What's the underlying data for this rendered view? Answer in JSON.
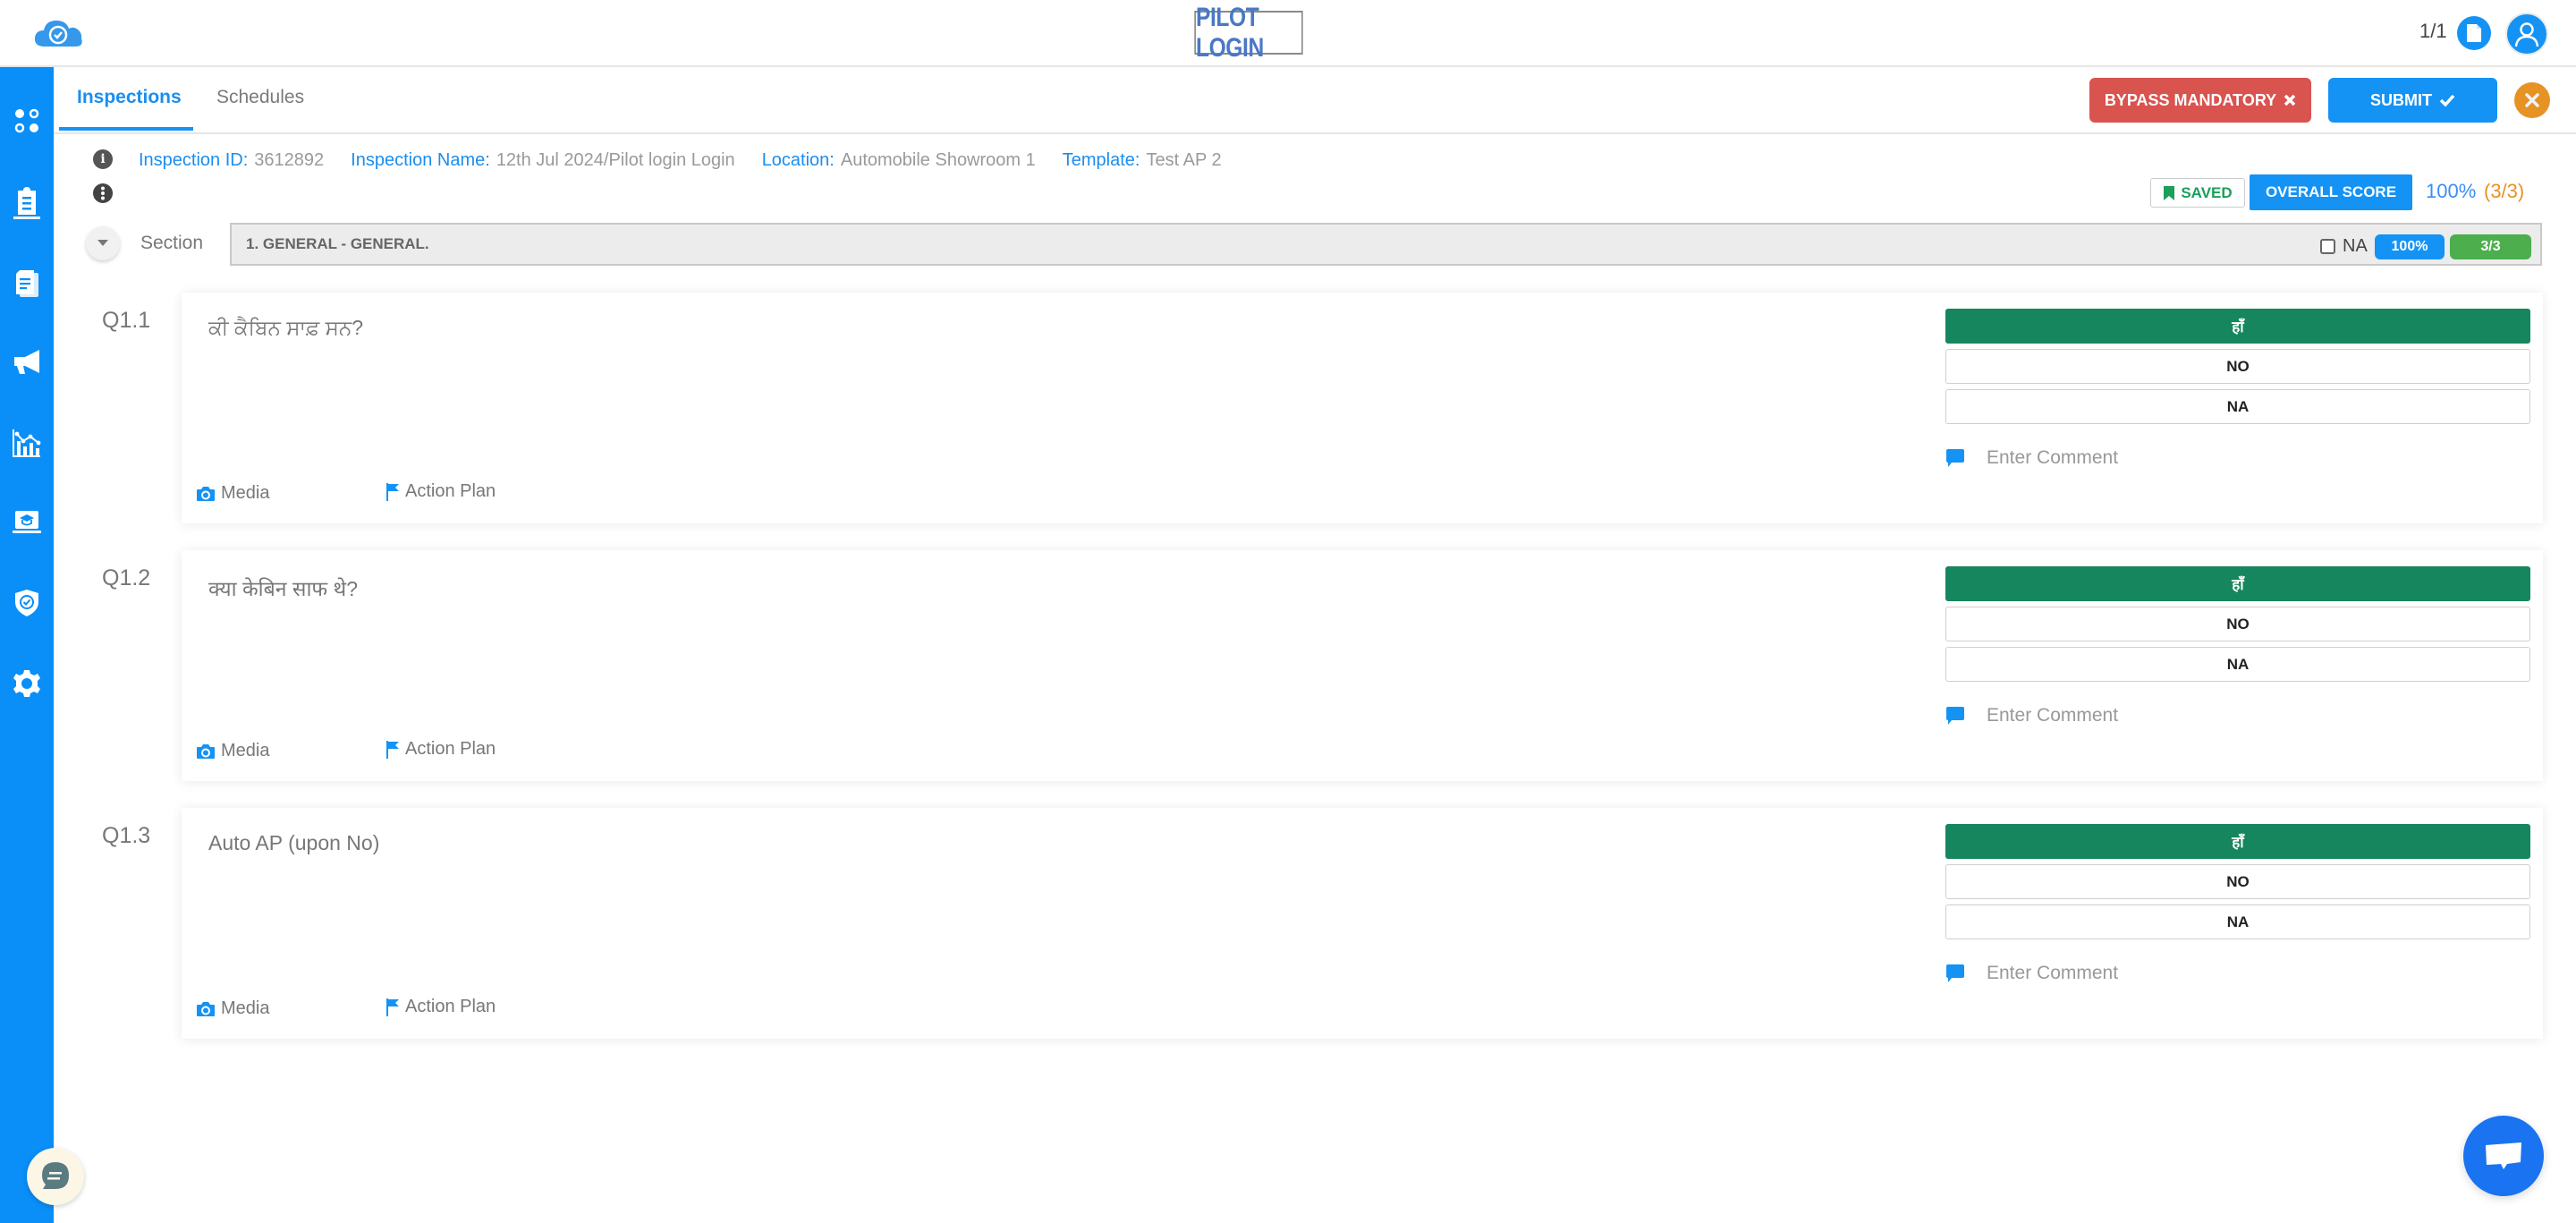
{
  "header": {
    "brand": "PILOT LOGIN",
    "page_count": "1/1",
    "icons": {
      "logo": "cloud-check-icon",
      "doc": "file-icon",
      "user": "user-icon"
    }
  },
  "sidebar": {
    "items": [
      {
        "name": "dashboard",
        "icon": "apps-icon"
      },
      {
        "name": "inspections",
        "icon": "clipboard-icon"
      },
      {
        "name": "documents",
        "icon": "documents-icon"
      },
      {
        "name": "announcements",
        "icon": "megaphone-icon"
      },
      {
        "name": "analytics",
        "icon": "chart-icon"
      },
      {
        "name": "training",
        "icon": "graduation-laptop-icon"
      },
      {
        "name": "compliance",
        "icon": "shield-check-icon"
      },
      {
        "name": "settings",
        "icon": "gear-icon"
      }
    ]
  },
  "tabs": [
    {
      "label": "Inspections",
      "active": true
    },
    {
      "label": "Schedules",
      "active": false
    }
  ],
  "actions": {
    "bypass_label": "BYPASS MANDATORY",
    "submit_label": "SUBMIT",
    "colors": {
      "bypass": "#d9534f",
      "submit": "#1493f5",
      "close": "#e69224"
    }
  },
  "info": {
    "inspection_id_label": "Inspection ID:",
    "inspection_id": "3612892",
    "inspection_name_label": "Inspection Name:",
    "inspection_name": "12th Jul 2024/Pilot login Login",
    "location_label": "Location:",
    "location": "Automobile Showroom 1",
    "template_label": "Template:",
    "template": "Test AP 2"
  },
  "score": {
    "saved_label": "SAVED",
    "overall_label": "OVERALL SCORE",
    "percent": "100%",
    "fraction": "(3/3)"
  },
  "section": {
    "label": "Section",
    "title": "1. GENERAL - GENERAL.",
    "na_label": "NA",
    "na_checked": false,
    "percent": "100%",
    "fraction": "3/3"
  },
  "questions": [
    {
      "number": "Q1.1",
      "text": "ਕੀ ਕੈਬਿਨ ਸਾਫ਼ ਸਨ?",
      "answers": [
        "हाँ",
        "NO",
        "NA"
      ],
      "selected": 0,
      "comment_placeholder": "Enter Comment",
      "media_label": "Media",
      "action_plan_label": "Action Plan"
    },
    {
      "number": "Q1.2",
      "text": "क्या केबिन साफ थे?",
      "answers": [
        "हाँ",
        "NO",
        "NA"
      ],
      "selected": 0,
      "comment_placeholder": "Enter Comment",
      "media_label": "Media",
      "action_plan_label": "Action Plan"
    },
    {
      "number": "Q1.3",
      "text": "Auto AP (upon No)",
      "answers": [
        "हाँ",
        "NO",
        "NA"
      ],
      "selected": 0,
      "comment_placeholder": "Enter Comment",
      "media_label": "Media",
      "action_plan_label": "Action Plan"
    }
  ],
  "widgets": {
    "help_chat": "chat-bubble-icon",
    "live_chat": "message-icon"
  }
}
